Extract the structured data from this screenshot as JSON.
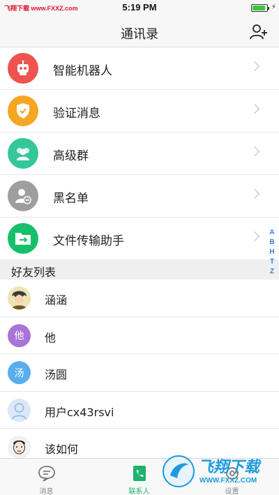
{
  "status_bar": {
    "watermark_left": "飞翔下载 www.FXXZ.com",
    "time": "5:19 PM",
    "battery_level": 0.9
  },
  "nav": {
    "title": "通讯录",
    "add_friend_icon": "add-user-icon"
  },
  "functions": [
    {
      "label": "智能机器人",
      "icon": "robot-icon",
      "color": "#ef5350"
    },
    {
      "label": "验证消息",
      "icon": "shield-check-icon",
      "color": "#f6a623"
    },
    {
      "label": "高级群",
      "icon": "group-icon",
      "color": "#35c79a"
    },
    {
      "label": "黑名单",
      "icon": "blocked-user-icon",
      "color": "#9e9e9e"
    },
    {
      "label": "文件传输助手",
      "icon": "folder-transfer-icon",
      "color": "#16c06a"
    }
  ],
  "friends_section": {
    "title": "好友列表"
  },
  "index_letters": [
    "A",
    "B",
    "H",
    "T",
    "Z"
  ],
  "friends": [
    {
      "name": "涵涵",
      "avatar_text": ""
    },
    {
      "name": "他",
      "avatar_text": "他"
    },
    {
      "name": "汤圆",
      "avatar_text": "汤"
    },
    {
      "name": "用户cx43rsvi",
      "avatar_text": ""
    },
    {
      "name": "该如何",
      "avatar_text": ""
    }
  ],
  "tabs": [
    {
      "label": "消息",
      "icon": "chat-icon",
      "active": false
    },
    {
      "label": "联系人",
      "icon": "contacts-icon",
      "active": true
    },
    {
      "label": "设置",
      "icon": "settings-icon",
      "active": false
    }
  ],
  "watermark": {
    "brand": "飞翔下载",
    "url": "WWW.FXXZ.COM"
  },
  "colors": {
    "accent_green": "#1cb36b",
    "index_blue": "#2f7fe4"
  }
}
